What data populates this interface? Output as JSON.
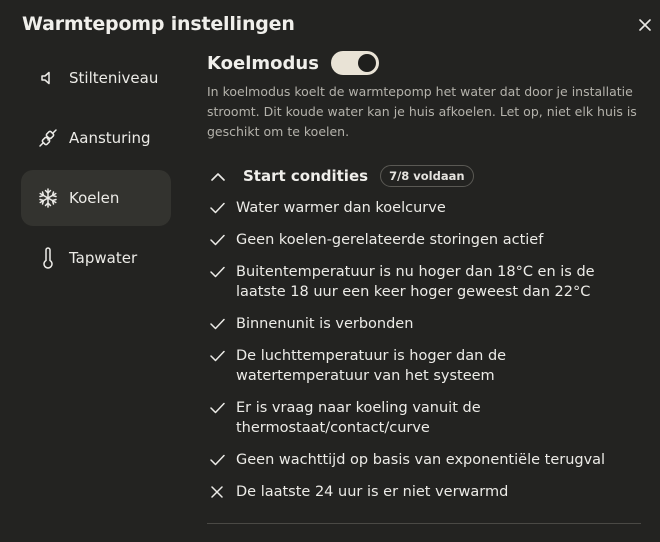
{
  "dialog": {
    "title": "Warmtepomp instellingen"
  },
  "sidebar": {
    "items": [
      {
        "label": "Stilteniveau",
        "icon": "speaker-icon"
      },
      {
        "label": "Aansturing",
        "icon": "plug-icon"
      },
      {
        "label": "Koelen",
        "icon": "snowflake-icon",
        "active": true
      },
      {
        "label": "Tapwater",
        "icon": "thermometer-icon"
      }
    ]
  },
  "cooling": {
    "title": "Koelmodus",
    "enabled": true,
    "description": "In koelmodus koelt de warmtepomp het water dat door je installatie stroomt. Dit koude water kan je huis afkoelen. Let op, niet elk huis is geschikt om te koelen."
  },
  "conditions": {
    "title": "Start condities",
    "badge": "7/8 voldaan",
    "items": [
      {
        "text": "Water warmer dan koelcurve",
        "met": true
      },
      {
        "text": "Geen koelen-gerelateerde storingen actief",
        "met": true
      },
      {
        "text": "Buitentemperatuur is nu hoger dan 18°C en is de laatste 18 uur een keer hoger geweest dan 22°C",
        "met": true
      },
      {
        "text": "Binnenunit is verbonden",
        "met": true
      },
      {
        "text": "De luchttemperatuur is hoger dan de watertemperatuur van het systeem",
        "met": true
      },
      {
        "text": "Er is vraag naar koeling vanuit de thermostaat/contact/curve",
        "met": true
      },
      {
        "text": "Geen wachttijd op basis van exponentiële terugval",
        "met": true
      },
      {
        "text": "De laatste 24 uur is er niet verwarmd",
        "met": false
      }
    ]
  },
  "colors": {
    "background": "#232321",
    "active_nav": "#33332f",
    "toggle_on": "#e9e3d6",
    "text": "#ecebe7",
    "muted_text": "#b4b2ab"
  }
}
